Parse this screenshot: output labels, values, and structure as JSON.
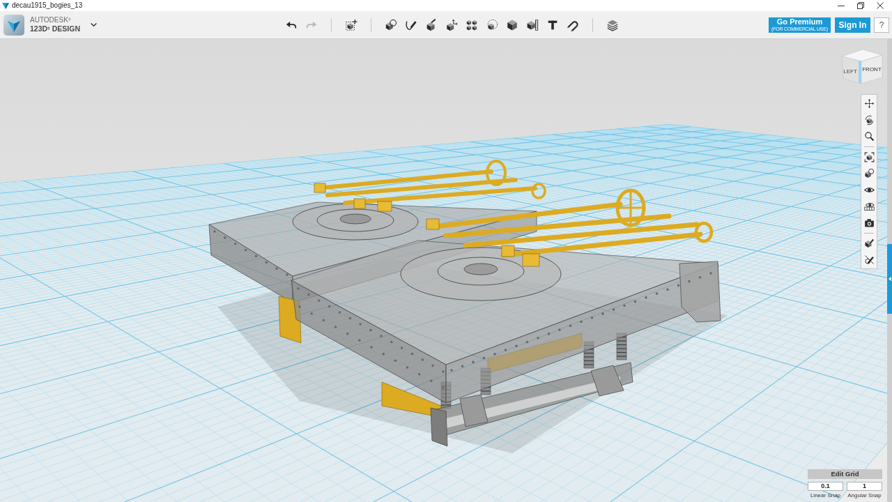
{
  "window": {
    "title": "decau1915_bogies_13"
  },
  "brand": {
    "company": "AUTODESK$^{®}$",
    "product": "123D$^{®}$ DESIGN"
  },
  "toolbar": {
    "groups": [
      {
        "items": [
          {
            "kind": "undo",
            "disabled": false
          },
          {
            "kind": "redo",
            "disabled": true
          }
        ]
      },
      {
        "items": [
          {
            "kind": "transform",
            "disabled": false
          }
        ]
      },
      {
        "items": [
          {
            "kind": "primitives",
            "disabled": false
          },
          {
            "kind": "sketch",
            "disabled": false
          },
          {
            "kind": "construct",
            "disabled": false
          },
          {
            "kind": "modify",
            "disabled": false
          },
          {
            "kind": "pattern",
            "disabled": false
          },
          {
            "kind": "grouping",
            "disabled": false
          },
          {
            "kind": "combine",
            "disabled": false
          },
          {
            "kind": "measure",
            "disabled": false
          },
          {
            "kind": "text",
            "disabled": false
          },
          {
            "kind": "snap",
            "disabled": false
          }
        ]
      },
      {
        "items": [
          {
            "kind": "materials",
            "disabled": false
          }
        ]
      }
    ]
  },
  "account": {
    "premium": {
      "label": "Go Premium",
      "note": "(FOR COMMERCIAL USE)"
    },
    "sign_in": "Sign In",
    "help": "?"
  },
  "view_cube": {
    "left": "LEFT",
    "front": "FRONT"
  },
  "navigation": {
    "groups": [
      {
        "items": [
          {
            "kind": "pan"
          },
          {
            "kind": "orbit"
          },
          {
            "kind": "zoom"
          }
        ]
      },
      {
        "items": [
          {
            "kind": "fit"
          },
          {
            "kind": "views"
          },
          {
            "kind": "visibility"
          },
          {
            "kind": "materials"
          },
          {
            "kind": "snapshot"
          }
        ]
      },
      {
        "items": [
          {
            "kind": "outline"
          },
          {
            "kind": "edit"
          }
        ]
      }
    ]
  },
  "grid_panel": {
    "title": "Edit Grid",
    "linear_snap": {
      "value": "0.1",
      "label": "Linear Snap"
    },
    "angular_snap": {
      "value": "1",
      "label": "Angular Snap"
    }
  }
}
